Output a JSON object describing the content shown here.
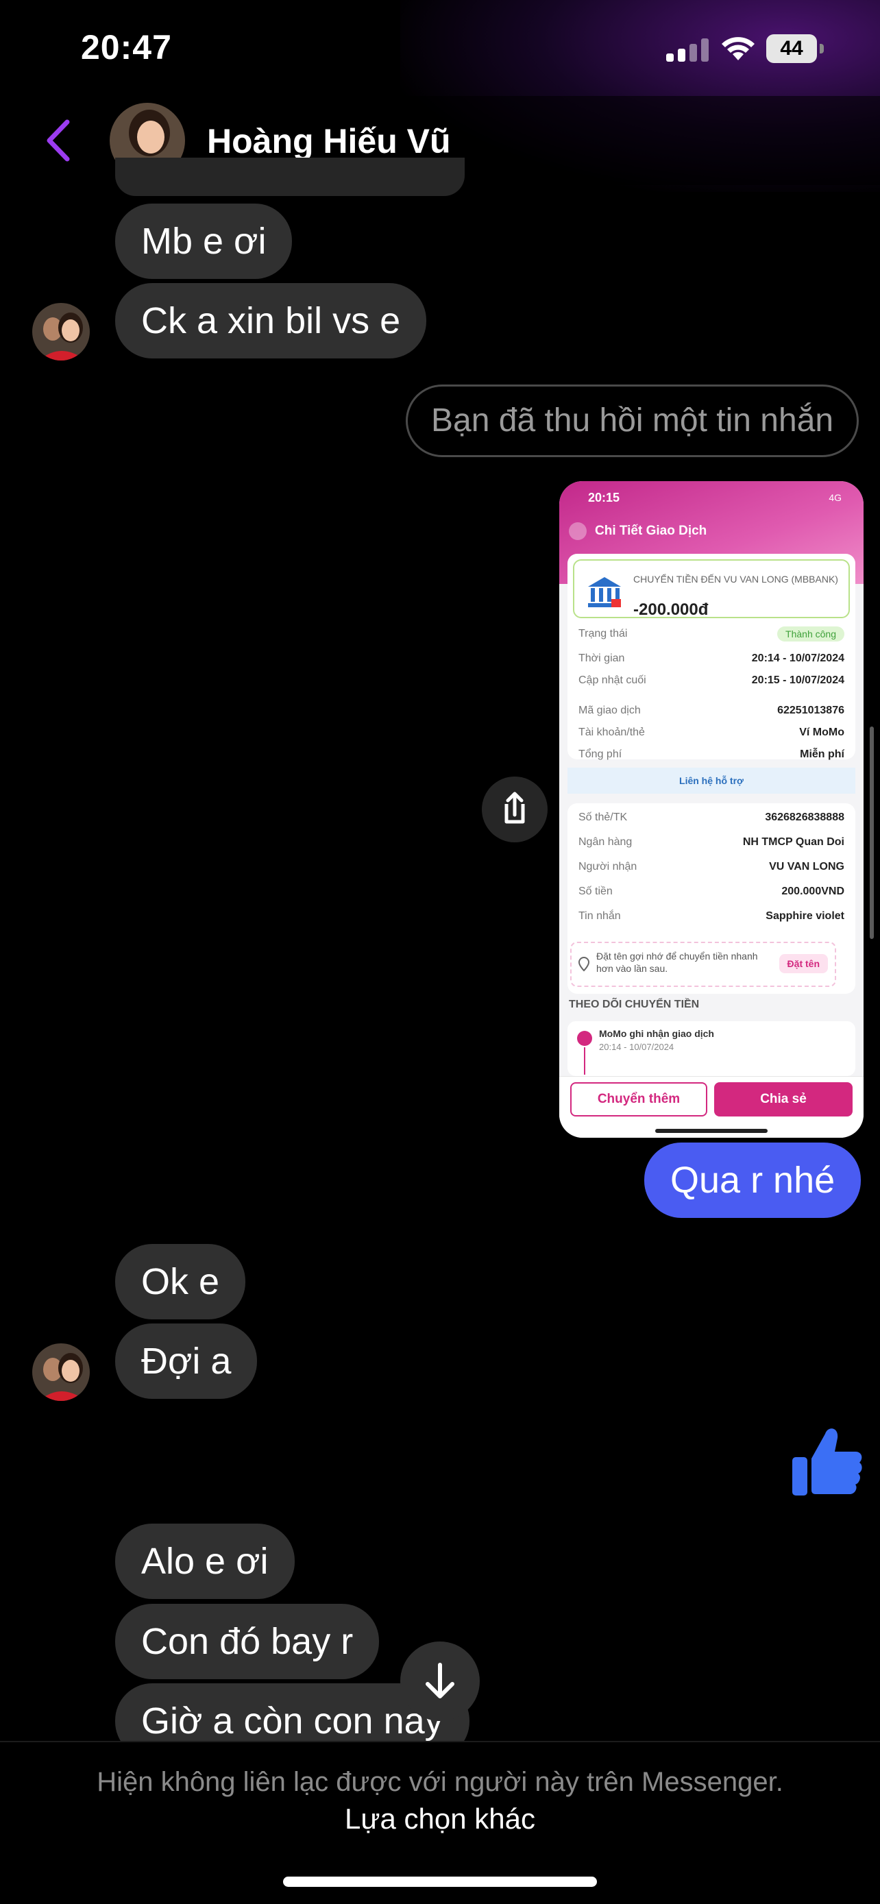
{
  "status_bar": {
    "time": "20:47",
    "battery": "44",
    "colors": {
      "glow": "#3c1464"
    }
  },
  "header": {
    "contact_name": "Hoàng Hiếu Vũ",
    "accent": "#9b3cf0"
  },
  "messages": {
    "received_1": "Mb e ơi",
    "received_2": "Ck a xin bil vs e",
    "recalled": "Bạn đã thu hồi một tin nhắn",
    "sent_1": "Qua r nhé",
    "received_3": "Ok e",
    "received_4": "Đợi a",
    "received_5": "Alo e ơi",
    "received_6": "Con đó bay r",
    "received_7": "Giờ a còn con nay"
  },
  "receipt": {
    "time": "20:15",
    "signal": "4G",
    "title": "Chi Tiết Giao Dịch",
    "transfer_to": "CHUYỂN TIỀN ĐẾN VU VAN LONG (MBBANK)",
    "amount": "-200.000đ",
    "rows1": [
      {
        "k": "Trạng thái",
        "v": "Thành công"
      },
      {
        "k": "Thời gian",
        "v": "20:14 - 10/07/2024"
      },
      {
        "k": "Cập nhật cuối",
        "v": "20:15 - 10/07/2024"
      },
      {
        "k": "Mã giao dịch",
        "v": "62251013876"
      },
      {
        "k": "Tài khoản/thẻ",
        "v": "Ví MoMo"
      },
      {
        "k": "Tổng phí",
        "v": "Miễn phí"
      }
    ],
    "support": "Liên hệ hỗ trợ",
    "rows2": [
      {
        "k": "Số thẻ/TK",
        "v": "3626826838888"
      },
      {
        "k": "Ngân hàng",
        "v": "NH TMCP Quan Doi"
      },
      {
        "k": "Người nhận",
        "v": "VU VAN LONG"
      },
      {
        "k": "Số tiền",
        "v": "200.000VND"
      },
      {
        "k": "Tin nhắn",
        "v": "Sapphire violet"
      }
    ],
    "hint": "Đặt tên gợi nhớ để chuyển tiền nhanh hơn vào lần sau.",
    "hint_button": "Đặt tên",
    "track_title": "THEO DÕI CHUYỂN TIỀN",
    "track_label": "MoMo ghi nhận giao dịch",
    "track_time": "20:14 - 10/07/2024",
    "button_more": "Chuyển thêm",
    "button_share": "Chia sẻ"
  },
  "footer": {
    "notice": "Hiện không liên lạc được với người này trên Messenger.",
    "other_choice": "Lựa chọn khác"
  },
  "icons": [
    "signal-icon",
    "wifi-icon",
    "battery-icon",
    "back-chevron-icon",
    "share-icon",
    "arrow-down-icon",
    "thumbs-up-icon"
  ]
}
